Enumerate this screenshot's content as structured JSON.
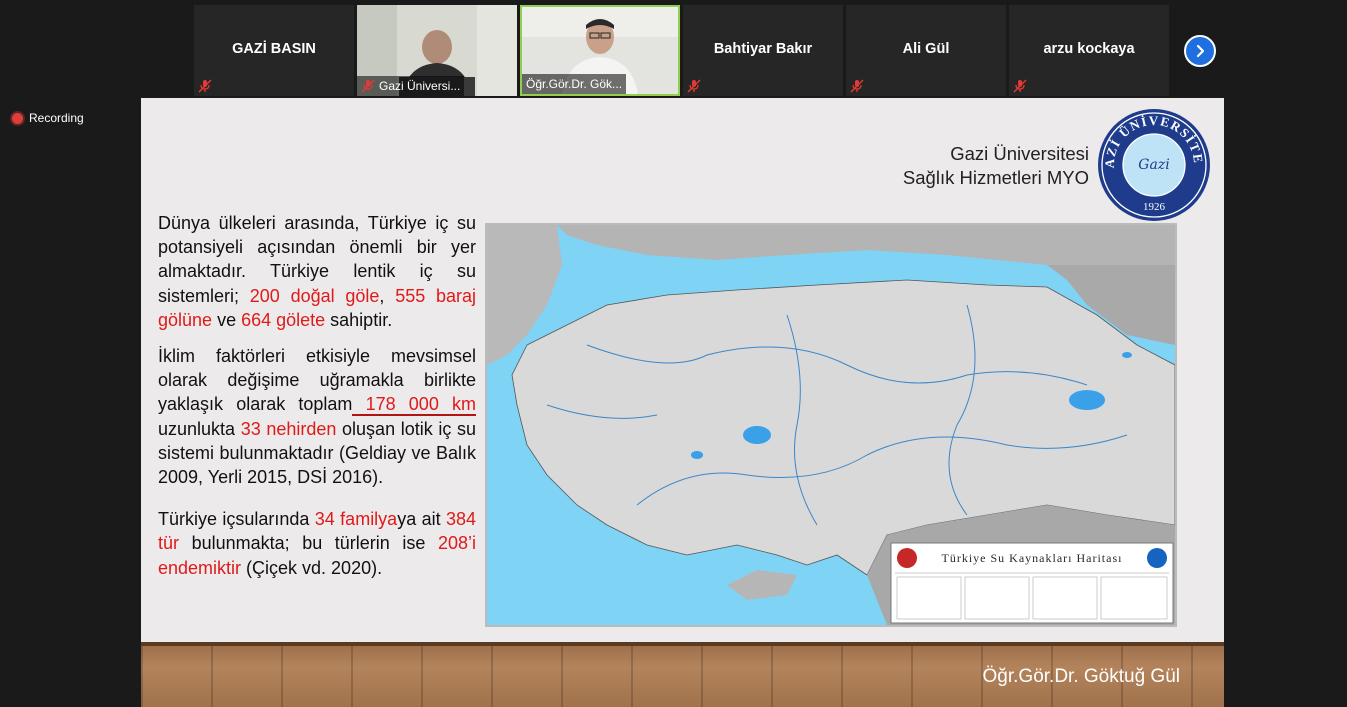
{
  "participants": [
    {
      "name": "GAZİ BASIN",
      "video": false,
      "muted": true
    },
    {
      "name": "Gazi Üniversi...",
      "video": true,
      "muted": true
    },
    {
      "name": "Öğr.Gör.Dr. Gök...",
      "video": true,
      "muted": false,
      "active": true
    },
    {
      "name": "Bahtiyar Bakır",
      "video": false,
      "muted": true
    },
    {
      "name": "Ali Gül",
      "video": false,
      "muted": true
    },
    {
      "name": "arzu kockaya",
      "video": false,
      "muted": true
    }
  ],
  "recording": {
    "label": "Recording"
  },
  "slide": {
    "institution_line1": "Gazi Üniversitesi",
    "institution_line2": "Sağlık Hizmetleri MYO",
    "logo_text": "GAZİ ÜNİVERSİTESİ",
    "logo_year": "1926",
    "logo_script": "Gazi",
    "p1": {
      "t1": "Dünya ülkeleri arasında, Türkiye iç su potansiyeli açısından önemli bir yer almaktadır. Türkiye lentik iç su sistemleri; ",
      "r1": "200 doğal göle",
      "t2": ", ",
      "r2": "555 baraj gölüne",
      "t3": " ve ",
      "r3": "664 gölete",
      "t4": " sahiptir."
    },
    "p2": {
      "t1": "İklim faktörleri etkisiyle mevsimsel olarak değişime uğramakla birlikte yaklaşık olarak toplam",
      "r1": " 178 000 km ",
      "t2": "uzunlukta ",
      "r2": "33 nehirden",
      "t3": " oluşan lotik iç su sistemi bulunmaktadır (Geldiay ve Balık 2009, Yerli 2015, DSİ 2016)."
    },
    "p3": {
      "t1": "Türkiye içsularında ",
      "r1": "34 familya",
      "t2": "ya ait ",
      "r2": "384 tür",
      "t3": " bulunmakta; bu türlerin ise ",
      "r3": "208’i endemiktir",
      "t4": " (Çiçek vd. 2020)."
    },
    "map_title": "Türkiye Su Kaynakları Haritası",
    "presenter": "Öğr.Gör.Dr. Göktuğ Gül"
  },
  "colors": {
    "accent": "#1f6fde",
    "highlight": "#e01a1a",
    "active_border": "#8fd14f",
    "sea": "#7fd3f5"
  }
}
